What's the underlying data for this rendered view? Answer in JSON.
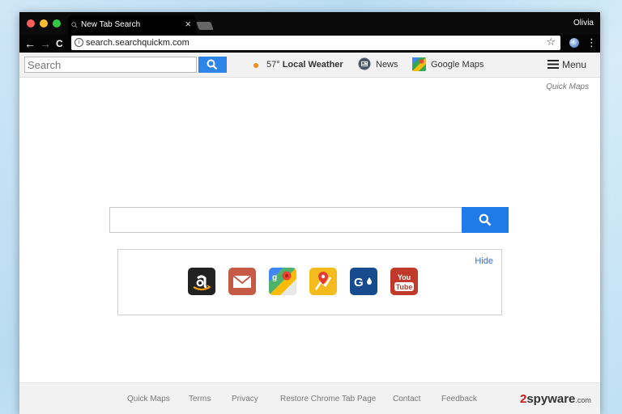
{
  "browser": {
    "tab_title": "New Tab Search",
    "tab_close": "×",
    "user_name": "Olivia",
    "url": "search.searchquickm.com",
    "nav": {
      "back": "←",
      "forward": "→",
      "reload": "C"
    },
    "star": "☆",
    "menu_dots": "⋮",
    "info": "i"
  },
  "toolbar": {
    "search_placeholder": "Search",
    "weather_temp": "57°",
    "weather_label": "Local Weather",
    "news_label": "News",
    "maps_label": "Google Maps",
    "menu_label": "Menu"
  },
  "page": {
    "quick_maps": "Quick Maps",
    "hide_label": "Hide",
    "tiles": [
      {
        "name": "amazon",
        "icon": "amazon-icon",
        "color": "#222222"
      },
      {
        "name": "mail",
        "icon": "mail-icon",
        "color": "#c75a44"
      },
      {
        "name": "google-maps",
        "icon": "google-maps-icon",
        "color": "#3a9b3a"
      },
      {
        "name": "directions",
        "icon": "directions-icon",
        "color": "#f3bb1b"
      },
      {
        "name": "gas",
        "icon": "gas-icon",
        "color": "#174a8e"
      },
      {
        "name": "youtube",
        "icon": "youtube-icon",
        "color": "#c0392b"
      }
    ],
    "youtube_text": [
      "You",
      "Tube"
    ]
  },
  "footer": {
    "links": [
      "Quick Maps",
      "Terms",
      "Privacy",
      "Restore Chrome Tab Page",
      "Contact",
      "Feedback"
    ],
    "watermark_2": "2",
    "watermark_text": "spyware",
    "watermark_domain": ".com"
  },
  "colors": {
    "accent_blue": "#1f7be8",
    "traffic_red": "#fc5f57",
    "traffic_yellow": "#fdbc2e",
    "traffic_green": "#33c748"
  }
}
